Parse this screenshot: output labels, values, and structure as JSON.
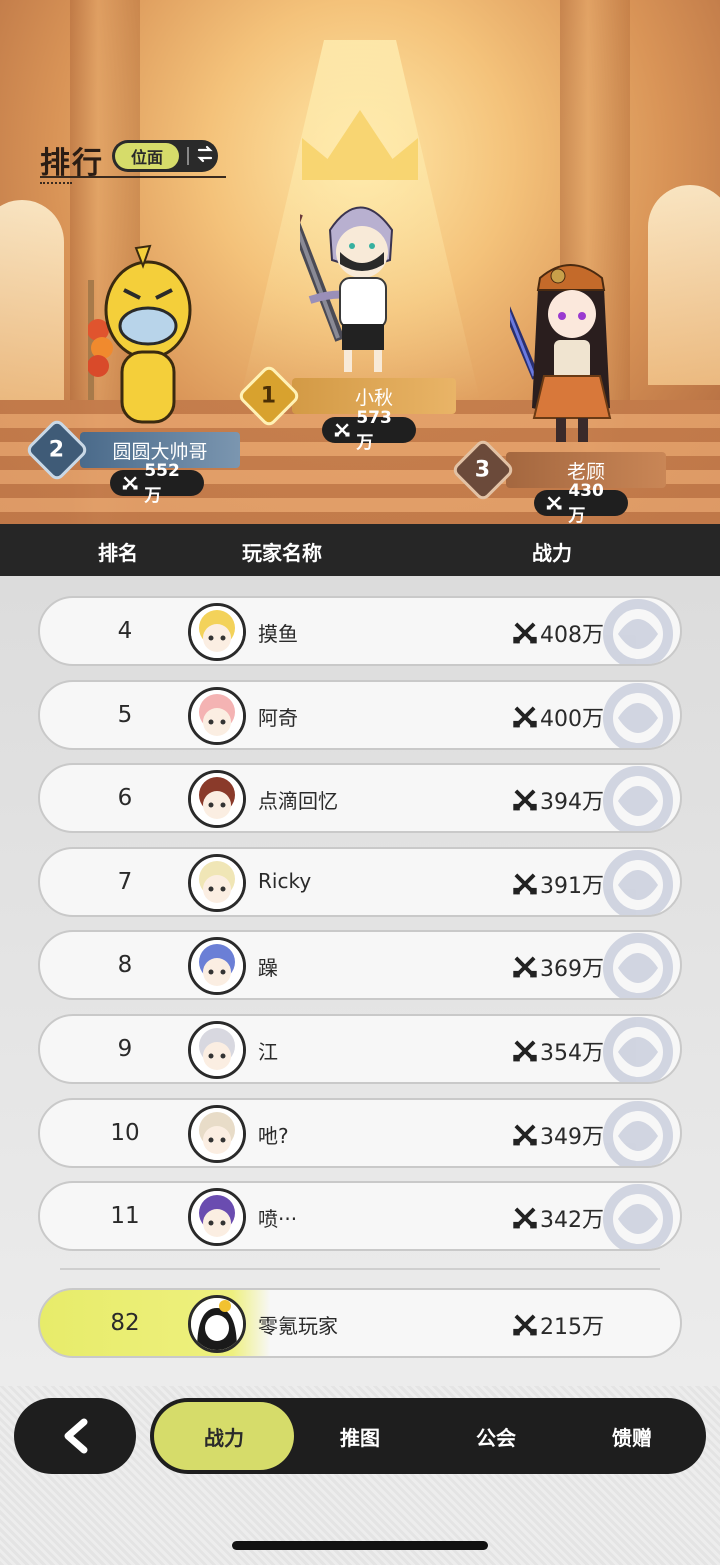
{
  "hero": {
    "title": "排行",
    "mode_label": "位面",
    "mode_swap_icon": "swap-arrows-icon",
    "podium": [
      {
        "rank": "2",
        "name": "圆圆大帅哥",
        "power": "552万"
      },
      {
        "rank": "1",
        "name": "小秋",
        "power": "573万"
      },
      {
        "rank": "3",
        "name": "老顾",
        "power": "430万"
      }
    ]
  },
  "table": {
    "headers": {
      "rank": "排名",
      "player": "玩家名称",
      "power": "战力"
    },
    "rows": [
      {
        "rank": "4",
        "name": "摸鱼",
        "power": "408万",
        "avatar_color": "#f3d25a"
      },
      {
        "rank": "5",
        "name": "阿奇",
        "power": "400万",
        "avatar_color": "#f4b3b3"
      },
      {
        "rank": "6",
        "name": "点滴回忆",
        "power": "394万",
        "avatar_color": "#8a3a2a"
      },
      {
        "rank": "7",
        "name": "Ricky",
        "power": "391万",
        "avatar_color": "#f0e6b6"
      },
      {
        "rank": "8",
        "name": "躁",
        "power": "369万",
        "avatar_color": "#6b7fd6"
      },
      {
        "rank": "9",
        "name": "江",
        "power": "354万",
        "avatar_color": "#d8d8e0"
      },
      {
        "rank": "10",
        "name": "吔?",
        "power": "349万",
        "avatar_color": "#e8dcc8"
      },
      {
        "rank": "11",
        "name": "喷···",
        "power": "342万",
        "avatar_color": "#6a4cb0"
      }
    ],
    "me": {
      "rank": "82",
      "name": "零氪玩家",
      "power": "215万",
      "avatar_color": "#1a1a1a"
    }
  },
  "nav": {
    "back_icon": "chevron-left-icon",
    "tabs": [
      {
        "label": "战力",
        "active": true
      },
      {
        "label": "推图",
        "active": false
      },
      {
        "label": "公会",
        "active": false
      },
      {
        "label": "馈赠",
        "active": false
      }
    ]
  },
  "colors": {
    "accent": "#d6dc6a",
    "dark": "#1e1e1e"
  }
}
